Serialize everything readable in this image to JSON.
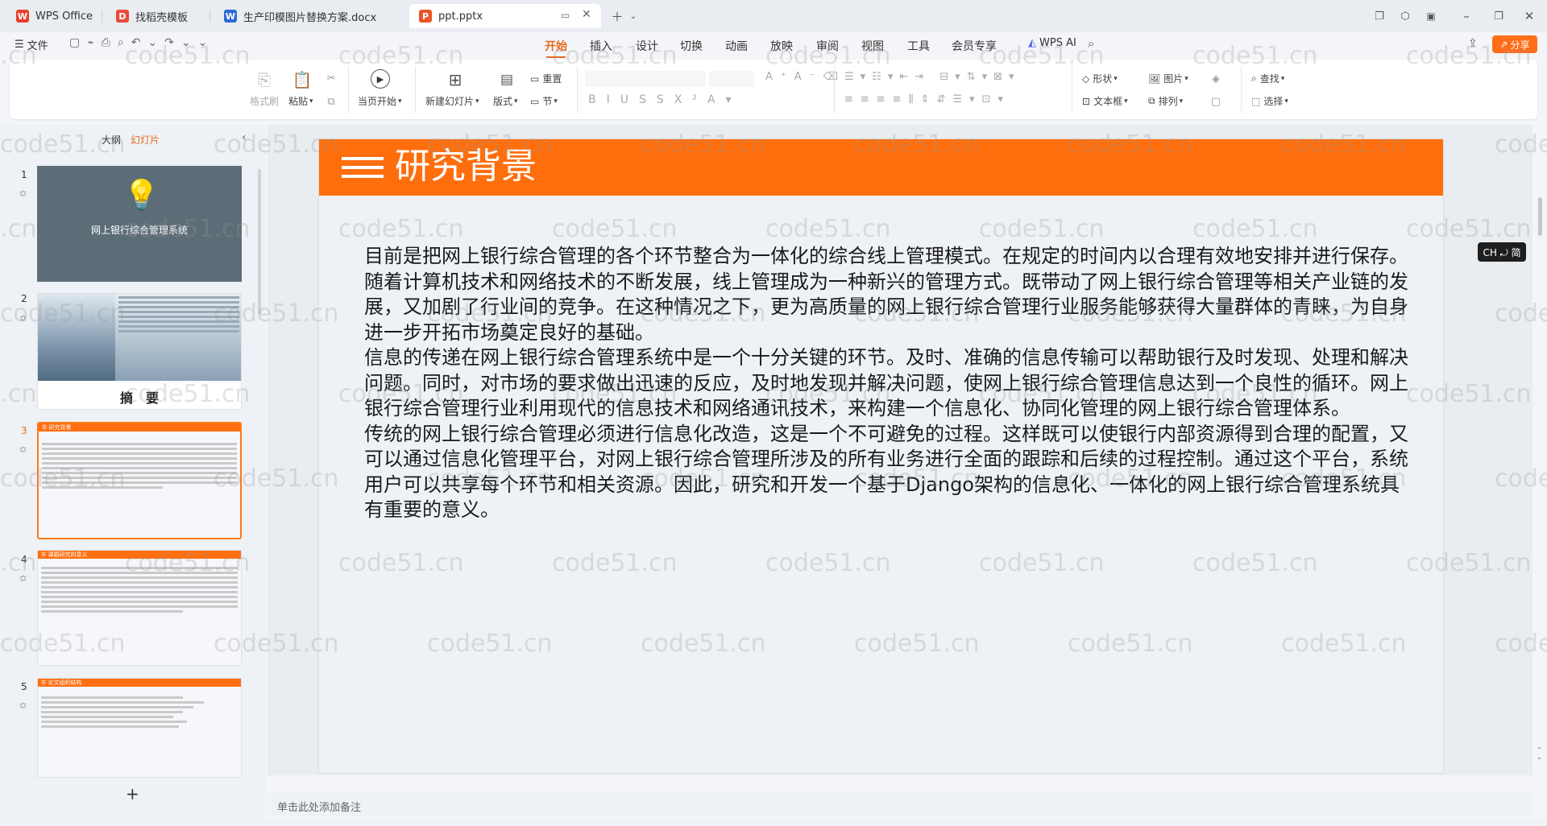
{
  "tabs": [
    {
      "label": "WPS Office",
      "icon": "wps-logo-icon",
      "color": "#e8412e"
    },
    {
      "label": "找稻壳模板",
      "icon": "docer-icon",
      "color": "#e84a3a"
    },
    {
      "label": "生产印模图片替换方案.docx",
      "icon": "word-doc-icon",
      "color": "#2b6bd6"
    },
    {
      "label": "ppt.pptx",
      "icon": "ppt-doc-icon",
      "color": "#e8552a"
    }
  ],
  "menu": {
    "file": "文件",
    "tabs": [
      "开始",
      "插入",
      "设计",
      "切换",
      "动画",
      "放映",
      "审阅",
      "视图",
      "工具",
      "会员专享"
    ],
    "wps_ai": "WPS AI",
    "share": "分享"
  },
  "ribbon": {
    "format_brush": "格式刷",
    "paste": "粘贴",
    "start_from": "当页开始",
    "new_slide": "新建幻灯片",
    "layout": "版式",
    "reset": "重置",
    "section": "节",
    "shape": "形状",
    "picture": "图片",
    "textbox": "文本框",
    "arrange": "排列",
    "find": "查找",
    "select": "选择"
  },
  "left_panel": {
    "outline": "大纲",
    "slides": "幻灯片",
    "thumbs": [
      {
        "num": "1",
        "title": "网上银行综合管理系统"
      },
      {
        "num": "2",
        "title": "摘　要"
      },
      {
        "num": "3",
        "title": "研究背景"
      },
      {
        "num": "4",
        "title": "课题研究的意义"
      },
      {
        "num": "5",
        "title": "论文组织结构"
      }
    ],
    "add": "+"
  },
  "slide": {
    "title": "研究背景",
    "paragraphs": [
      "目前是把网上银行综合管理的各个环节整合为一体化的综合线上管理模式。在规定的时间内以合理有效地安排并进行保存。",
      "随着计算机技术和网络技术的不断发展，线上管理成为一种新兴的管理方式。既带动了网上银行综合管理等相关产业链的发展，又加剧了行业间的竞争。在这种情况之下，更为高质量的网上银行综合管理行业服务能够获得大量群体的青睐，为自身进一步开拓市场奠定良好的基础。",
      "信息的传递在网上银行综合管理系统中是一个十分关键的环节。及时、准确的信息传输可以帮助银行及时发现、处理和解决问题。同时，对市场的要求做出迅速的反应，及时地发现并解决问题，使网上银行综合管理信息达到一个良性的循环。网上银行综合管理行业利用现代的信息技术和网络通讯技术，来构建一个信息化、协同化管理的网上银行综合管理体系。",
      "传统的网上银行综合管理必须进行信息化改造，这是一个不可避免的过程。这样既可以使银行内部资源得到合理的配置，又可以通过信息化管理平台，对网上银行综合管理所涉及的所有业务进行全面的跟踪和后续的过程控制。通过这个平台，系统用户可以共享每个环节和相关资源。因此，研究和开发一个基于Django架构的信息化、一体化的网上银行综合管理系统具有重要的意义。"
    ]
  },
  "ime_badge": "CH ⤾ 简",
  "notes_placeholder": "单击此处添加备注",
  "watermark": "code51.cn"
}
